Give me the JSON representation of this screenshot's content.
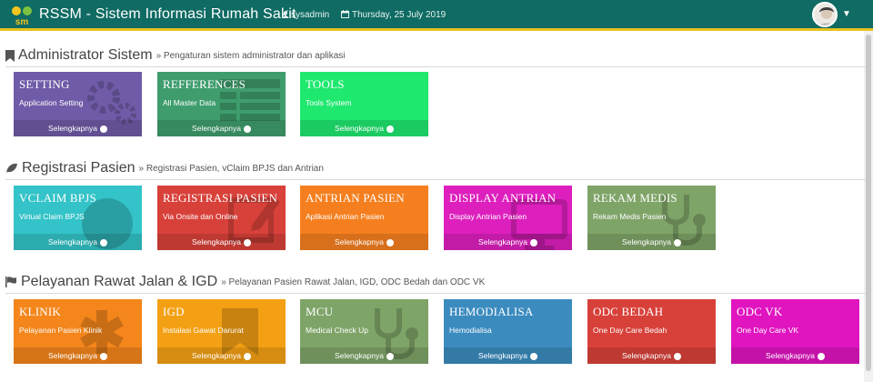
{
  "header": {
    "app_title": "RSSM - Sistem Informasi Rumah Sakit",
    "user": "sysadmin",
    "date": "Thursday, 25 July 2019",
    "logo_text": "sm",
    "brand_color": "#0f6b63",
    "accent_color": "#e6c21f"
  },
  "footer_label": "Selengkapnya",
  "sections": [
    {
      "title": "Administrator Sistem",
      "subtitle": "» Pengaturan sistem administrator dan aplikasi",
      "icon": "bookmark-icon",
      "tiles": [
        {
          "title": "SETTING",
          "subtitle": "Application Setting",
          "color": "#6f5ba7",
          "icon": "gears-icon"
        },
        {
          "title": "REFFERENCES",
          "subtitle": "All Master Data",
          "color": "#3f9d6d",
          "icon": "table-icon"
        },
        {
          "title": "TOOLS",
          "subtitle": "Tools System",
          "color": "#1fe86f",
          "icon": "tools-icon"
        }
      ]
    },
    {
      "title": "Registrasi Pasien",
      "subtitle": "» Registrasi Pasien, vClaim BPJS dan Antrian",
      "icon": "leaf-icon",
      "tiles": [
        {
          "title": "VCLAIM BPJS",
          "subtitle": "Virtual Claim BPJS",
          "color": "#33c3c8",
          "icon": "globe-icon"
        },
        {
          "title": "REGISTRASI PASIEN",
          "subtitle": "Via Onsite dan Online",
          "color": "#d8413a",
          "icon": "pencil-icon"
        },
        {
          "title": "ANTRIAN PASIEN",
          "subtitle": "Aplikasi Antrian Pasien",
          "color": "#f57f1f",
          "icon": "list-icon"
        },
        {
          "title": "DISPLAY ANTRIAN",
          "subtitle": "Display Antrian Pasien",
          "color": "#dd1fbd",
          "icon": "monitor-icon"
        },
        {
          "title": "REKAM MEDIS",
          "subtitle": "Rekam Medis Pasien",
          "color": "#7fa468",
          "icon": "stethoscope-icon"
        }
      ]
    },
    {
      "title": "Pelayanan Rawat Jalan & IGD",
      "subtitle": "» Pelayanan Pasien Rawat Jalan, IGD, ODC Bedah dan ODC VK",
      "icon": "flag-icon",
      "tiles": [
        {
          "title": "KLINIK",
          "subtitle": "Pelayanan Pasien Klinik",
          "color": "#f4861c",
          "icon": "asterisk-icon"
        },
        {
          "title": "IGD",
          "subtitle": "Instalasi Gawat Darurat",
          "color": "#f4a014",
          "icon": "bookmark-icon"
        },
        {
          "title": "MCU",
          "subtitle": "Medical Check Up",
          "color": "#7fa468",
          "icon": "stethoscope-icon"
        },
        {
          "title": "HEMODIALISA",
          "subtitle": "Hemodialisa",
          "color": "#3b8bbf",
          "icon": "none"
        },
        {
          "title": "ODC BEDAH",
          "subtitle": "One Day Care Bedah",
          "color": "#d8413a",
          "icon": "none"
        },
        {
          "title": "ODC VK",
          "subtitle": "One Day Care VK",
          "color": "#e015c0",
          "icon": "none"
        }
      ]
    }
  ]
}
